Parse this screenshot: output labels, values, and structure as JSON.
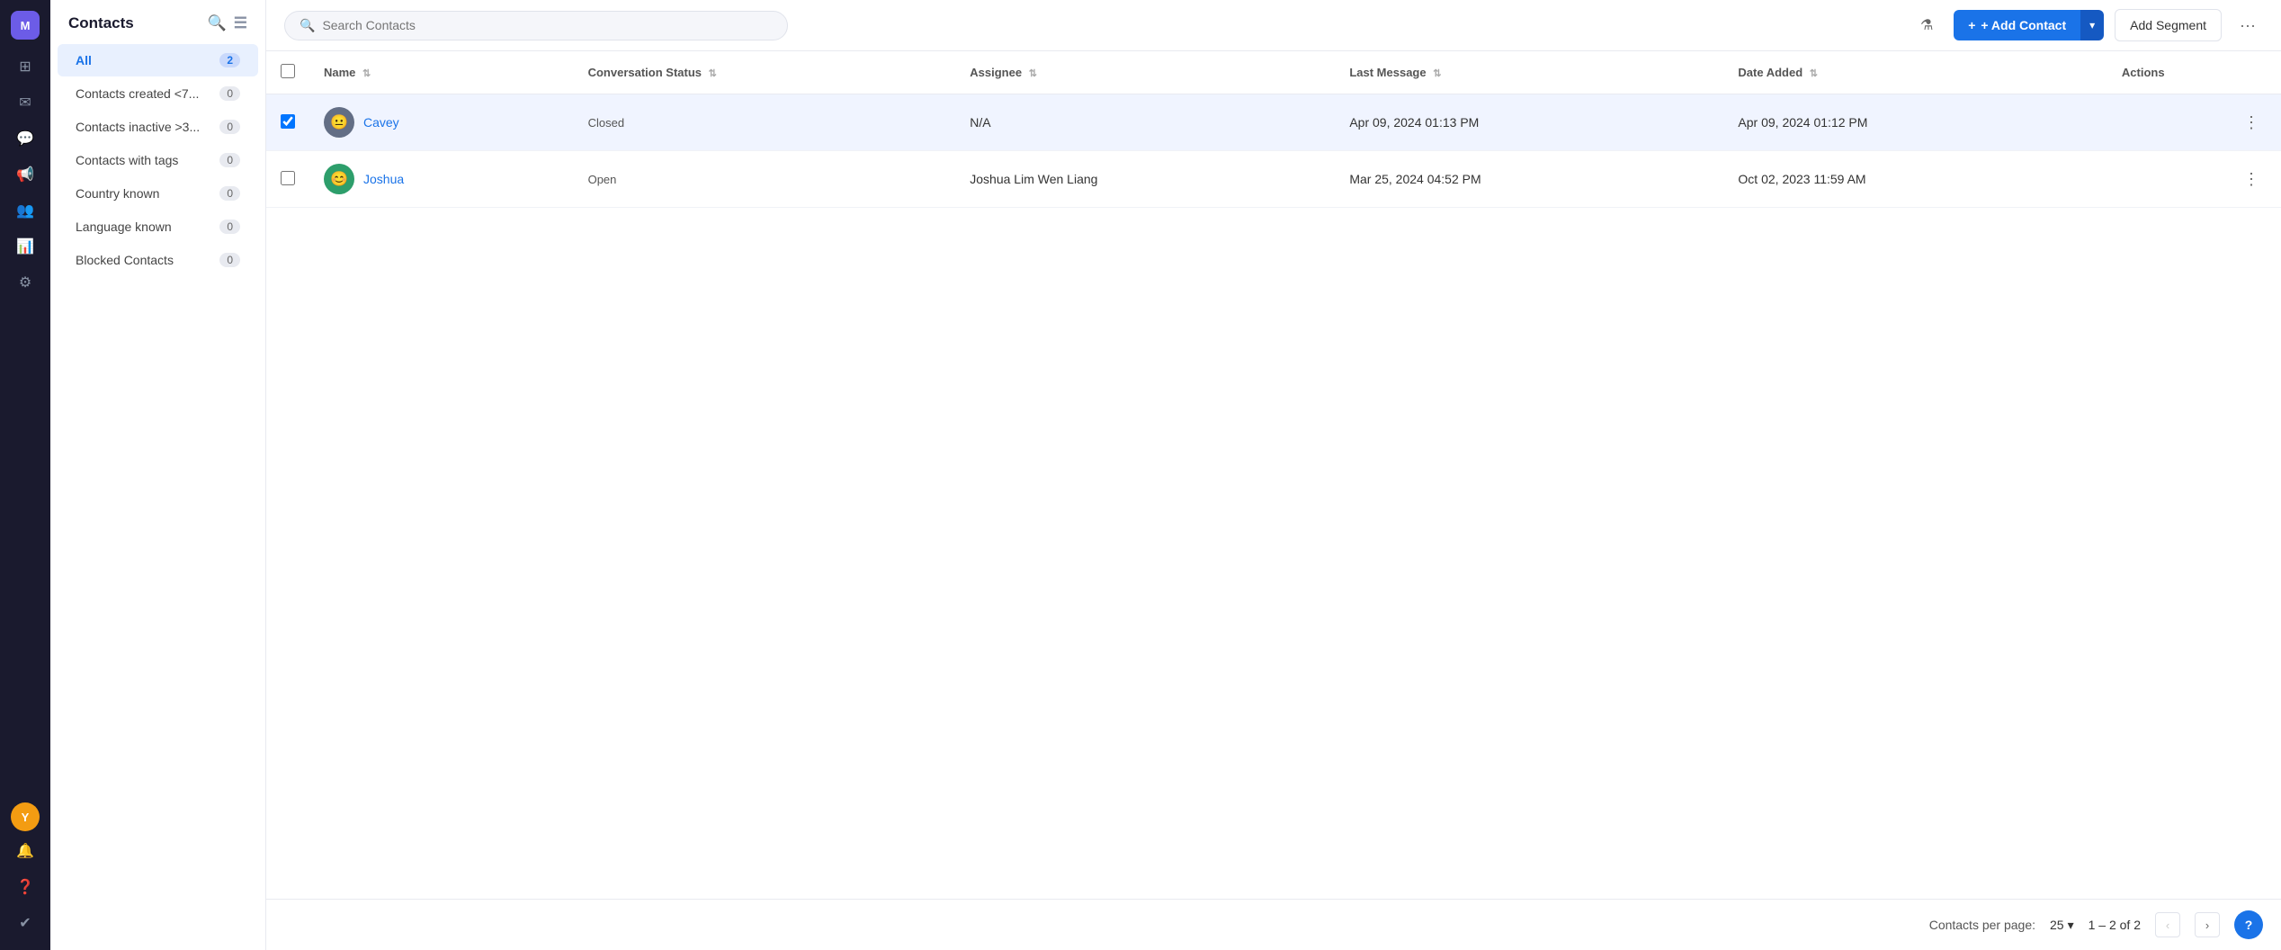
{
  "app": {
    "title": "Contacts",
    "user_initials": "M",
    "user_bottom_initials": "Y"
  },
  "nav": {
    "icons": [
      {
        "name": "grid-icon",
        "symbol": "⊞"
      },
      {
        "name": "inbox-icon",
        "symbol": "✉"
      },
      {
        "name": "chat-icon",
        "symbol": "💬"
      },
      {
        "name": "megaphone-icon",
        "symbol": "📢"
      },
      {
        "name": "contacts-icon",
        "symbol": "👥"
      },
      {
        "name": "reports-icon",
        "symbol": "📊"
      },
      {
        "name": "settings-icon",
        "symbol": "⚙"
      }
    ]
  },
  "sidebar": {
    "items": [
      {
        "id": "all",
        "label": "All",
        "count": "2",
        "active": true
      },
      {
        "id": "contacts-created",
        "label": "Contacts created <7...",
        "count": "0",
        "active": false
      },
      {
        "id": "contacts-inactive",
        "label": "Contacts inactive >3...",
        "count": "0",
        "active": false
      },
      {
        "id": "contacts-with-tags",
        "label": "Contacts with tags",
        "count": "0",
        "active": false
      },
      {
        "id": "country-known",
        "label": "Country known",
        "count": "0",
        "active": false
      },
      {
        "id": "language-known",
        "label": "Language known",
        "count": "0",
        "active": false
      },
      {
        "id": "blocked-contacts",
        "label": "Blocked Contacts",
        "count": "0",
        "active": false
      }
    ]
  },
  "toolbar": {
    "search_placeholder": "Search Contacts",
    "add_contact_label": "+ Add Contact",
    "add_segment_label": "Add Segment"
  },
  "table": {
    "columns": [
      {
        "id": "name",
        "label": "Name",
        "sortable": true
      },
      {
        "id": "conversation_status",
        "label": "Conversation Status",
        "sortable": true
      },
      {
        "id": "assignee",
        "label": "Assignee",
        "sortable": true
      },
      {
        "id": "last_message",
        "label": "Last Message",
        "sortable": true
      },
      {
        "id": "date_added",
        "label": "Date Added",
        "sortable": true
      },
      {
        "id": "actions",
        "label": "Actions",
        "sortable": false
      }
    ],
    "rows": [
      {
        "id": 1,
        "name": "Cavey",
        "avatar_emoji": "😐",
        "avatar_color": "gray",
        "conversation_status": "Closed",
        "assignee": "N/A",
        "last_message": "Apr 09, 2024 01:13 PM",
        "date_added": "Apr 09, 2024 01:12 PM",
        "selected": true
      },
      {
        "id": 2,
        "name": "Joshua",
        "avatar_emoji": "😊",
        "avatar_color": "teal",
        "conversation_status": "Open",
        "assignee": "Joshua Lim Wen Liang",
        "last_message": "Mar 25, 2024 04:52 PM",
        "date_added": "Oct 02, 2023 11:59 AM",
        "selected": false
      }
    ]
  },
  "footer": {
    "per_page_label": "Contacts per page:",
    "per_page_value": "25",
    "pagination_info": "1 – 2 of 2"
  }
}
